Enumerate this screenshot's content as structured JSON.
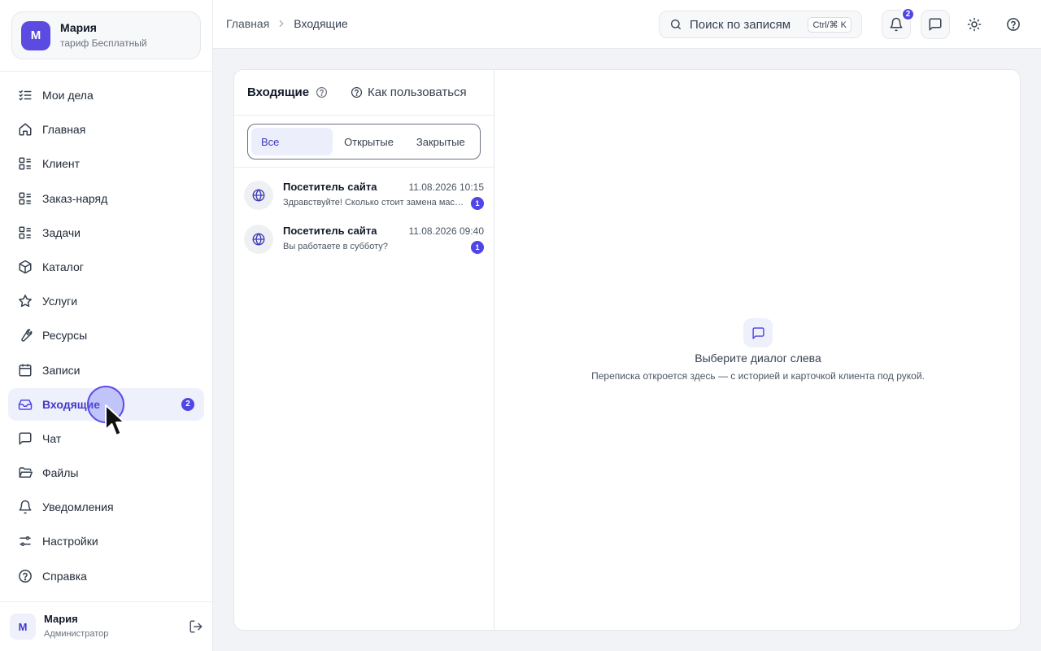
{
  "org": {
    "avatar": "М",
    "name": "Мария",
    "plan": "тариф Бесплатный"
  },
  "nav": [
    {
      "label": "Мои дела",
      "icon": "list-check-icon"
    },
    {
      "label": "Главная",
      "icon": "home-icon"
    },
    {
      "label": "Клиент",
      "icon": "list-grid-icon"
    },
    {
      "label": "Заказ-наряд",
      "icon": "list-grid-icon"
    },
    {
      "label": "Задачи",
      "icon": "list-grid-icon"
    },
    {
      "label": "Каталог",
      "icon": "package-icon"
    },
    {
      "label": "Услуги",
      "icon": "star-icon"
    },
    {
      "label": "Ресурсы",
      "icon": "wrench-icon"
    },
    {
      "label": "Записи",
      "icon": "calendar-icon"
    },
    {
      "label": "Входящие",
      "icon": "inbox-icon",
      "active": true,
      "badge": "2"
    },
    {
      "label": "Чат",
      "icon": "chat-icon"
    },
    {
      "label": "Файлы",
      "icon": "folder-icon"
    },
    {
      "label": "Уведомления",
      "icon": "bell-icon"
    },
    {
      "label": "Настройки",
      "icon": "sliders-icon"
    },
    {
      "label": "Справка",
      "icon": "help-icon"
    }
  ],
  "user": {
    "avatar": "М",
    "name": "Мария",
    "role": "Администратор"
  },
  "breadcrumb": {
    "home": "Главная",
    "current": "Входящие"
  },
  "search": {
    "placeholder": "Поиск по записям",
    "shortcut": "Ctrl/⌘ K"
  },
  "topbar": {
    "notifications_badge": "2"
  },
  "inbox": {
    "title": "Входящие",
    "howto": "Как пользоваться",
    "filters": [
      "Все",
      "Открытые",
      "Закрытые"
    ],
    "active_filter": "Все",
    "conversations": [
      {
        "name": "Посетитель сайта",
        "time": "11.08.2026 10:15",
        "preview": "Здравствуйте! Сколько стоит замена масла?",
        "unread": "1"
      },
      {
        "name": "Посетитель сайта",
        "time": "11.08.2026 09:40",
        "preview": "Вы работаете в субботу?",
        "unread": "1"
      }
    ]
  },
  "empty_state": {
    "title": "Выберите диалог слева",
    "subtitle": "Переписка откроется здесь — с историей и карточкой клиента под рукой."
  },
  "colors": {
    "accent": "#4f46e5",
    "active_bg": "#eef0fc",
    "main_bg": "#f2f3f6"
  }
}
